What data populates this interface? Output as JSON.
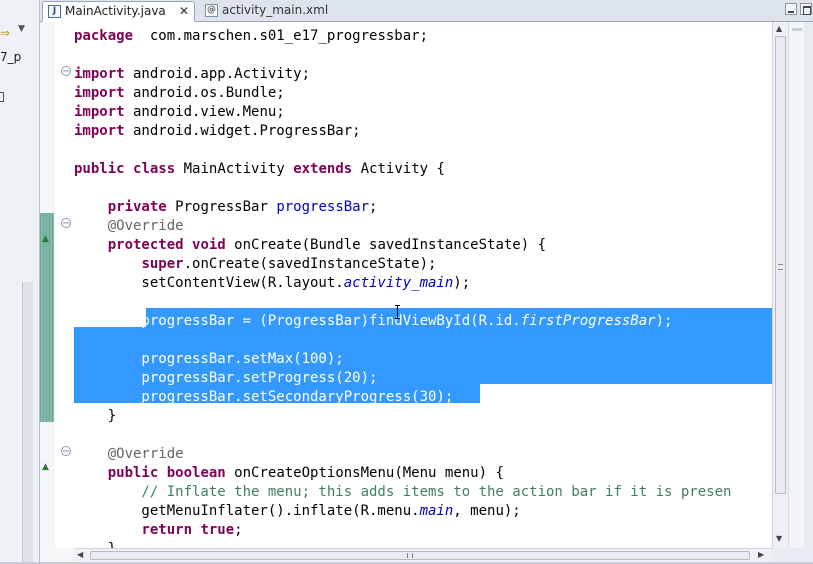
{
  "sidebar": {
    "clipped_label": "7_p"
  },
  "tabs": [
    {
      "label": "MainActivity.java",
      "icon": "java-file-icon",
      "active": true,
      "close": "✕"
    },
    {
      "label": "activity_main.xml",
      "icon": "xml-file-icon",
      "active": false
    }
  ],
  "editor": {
    "lines": [
      {
        "parts": [
          [
            "kw",
            "package"
          ],
          [
            "",
            "  com.marschen.s01_e17_progressbar;"
          ]
        ]
      },
      {
        "parts": [
          [
            "kw",
            "import"
          ],
          [
            "",
            " android.app.Activity;"
          ]
        ]
      },
      {
        "parts": [
          [
            "kw",
            "import"
          ],
          [
            "",
            " android.os.Bundle;"
          ]
        ]
      },
      {
        "parts": [
          [
            "kw",
            "import"
          ],
          [
            "",
            " android.view.Menu;"
          ]
        ]
      },
      {
        "parts": [
          [
            "kw",
            "import"
          ],
          [
            "",
            " android.widget.ProgressBar;"
          ]
        ]
      },
      {
        "parts": [
          [
            "kw",
            "public"
          ],
          [
            "",
            " "
          ],
          [
            "kw",
            "class"
          ],
          [
            "",
            " MainActivity "
          ],
          [
            "kw",
            "extends"
          ],
          [
            "",
            " Activity {"
          ]
        ]
      },
      {
        "parts": [
          [
            "",
            "    "
          ],
          [
            "kw",
            "private"
          ],
          [
            "",
            " ProgressBar "
          ],
          [
            "field",
            "progressBar"
          ],
          [
            "",
            ";"
          ]
        ]
      },
      {
        "parts": [
          [
            "ann",
            "    @Override"
          ]
        ]
      },
      {
        "parts": [
          [
            "",
            "    "
          ],
          [
            "kw",
            "protected"
          ],
          [
            "",
            " "
          ],
          [
            "kw",
            "void"
          ],
          [
            "",
            " onCreate(Bundle savedInstanceState) {"
          ]
        ]
      },
      {
        "parts": [
          [
            "",
            "        "
          ],
          [
            "kw",
            "super"
          ],
          [
            "",
            ".onCreate(savedInstanceState);"
          ]
        ]
      },
      {
        "parts": [
          [
            "",
            "        setContentView(R.layout."
          ],
          [
            "static",
            "activity_main"
          ],
          [
            "",
            ");"
          ]
        ]
      },
      {
        "parts": [
          [
            "",
            "        progressBar = (ProgressBar)findViewById(R.id."
          ],
          [
            "static",
            "firstProgressBar"
          ],
          [
            "",
            ");"
          ]
        ]
      },
      {
        "parts": [
          [
            "",
            "        progressBar.setMax(100);"
          ]
        ]
      },
      {
        "parts": [
          [
            "",
            "        progressBar.setProgress(20);"
          ]
        ]
      },
      {
        "parts": [
          [
            "",
            "        progressBar.setSecondaryProgress(30);"
          ]
        ]
      },
      {
        "parts": [
          [
            "",
            "    }"
          ]
        ]
      },
      {
        "parts": [
          [
            "ann",
            "    @Override"
          ]
        ]
      },
      {
        "parts": [
          [
            "",
            "    "
          ],
          [
            "kw",
            "public"
          ],
          [
            "",
            " "
          ],
          [
            "kw",
            "boolean"
          ],
          [
            "",
            " onCreateOptionsMenu(Menu menu) {"
          ]
        ]
      },
      {
        "parts": [
          [
            "cmt",
            "        // Inflate the menu; this adds items to the action bar if it is presen"
          ]
        ]
      },
      {
        "parts": [
          [
            "",
            "        getMenuInflater().inflate(R.menu."
          ],
          [
            "static",
            "main"
          ],
          [
            "",
            ", menu);"
          ]
        ]
      },
      {
        "parts": [
          [
            "",
            "        "
          ],
          [
            "kw",
            "return"
          ],
          [
            "",
            " "
          ],
          [
            "kw",
            "true"
          ],
          [
            "",
            ";"
          ]
        ]
      },
      {
        "parts": [
          [
            "",
            "    }"
          ]
        ]
      }
    ]
  }
}
